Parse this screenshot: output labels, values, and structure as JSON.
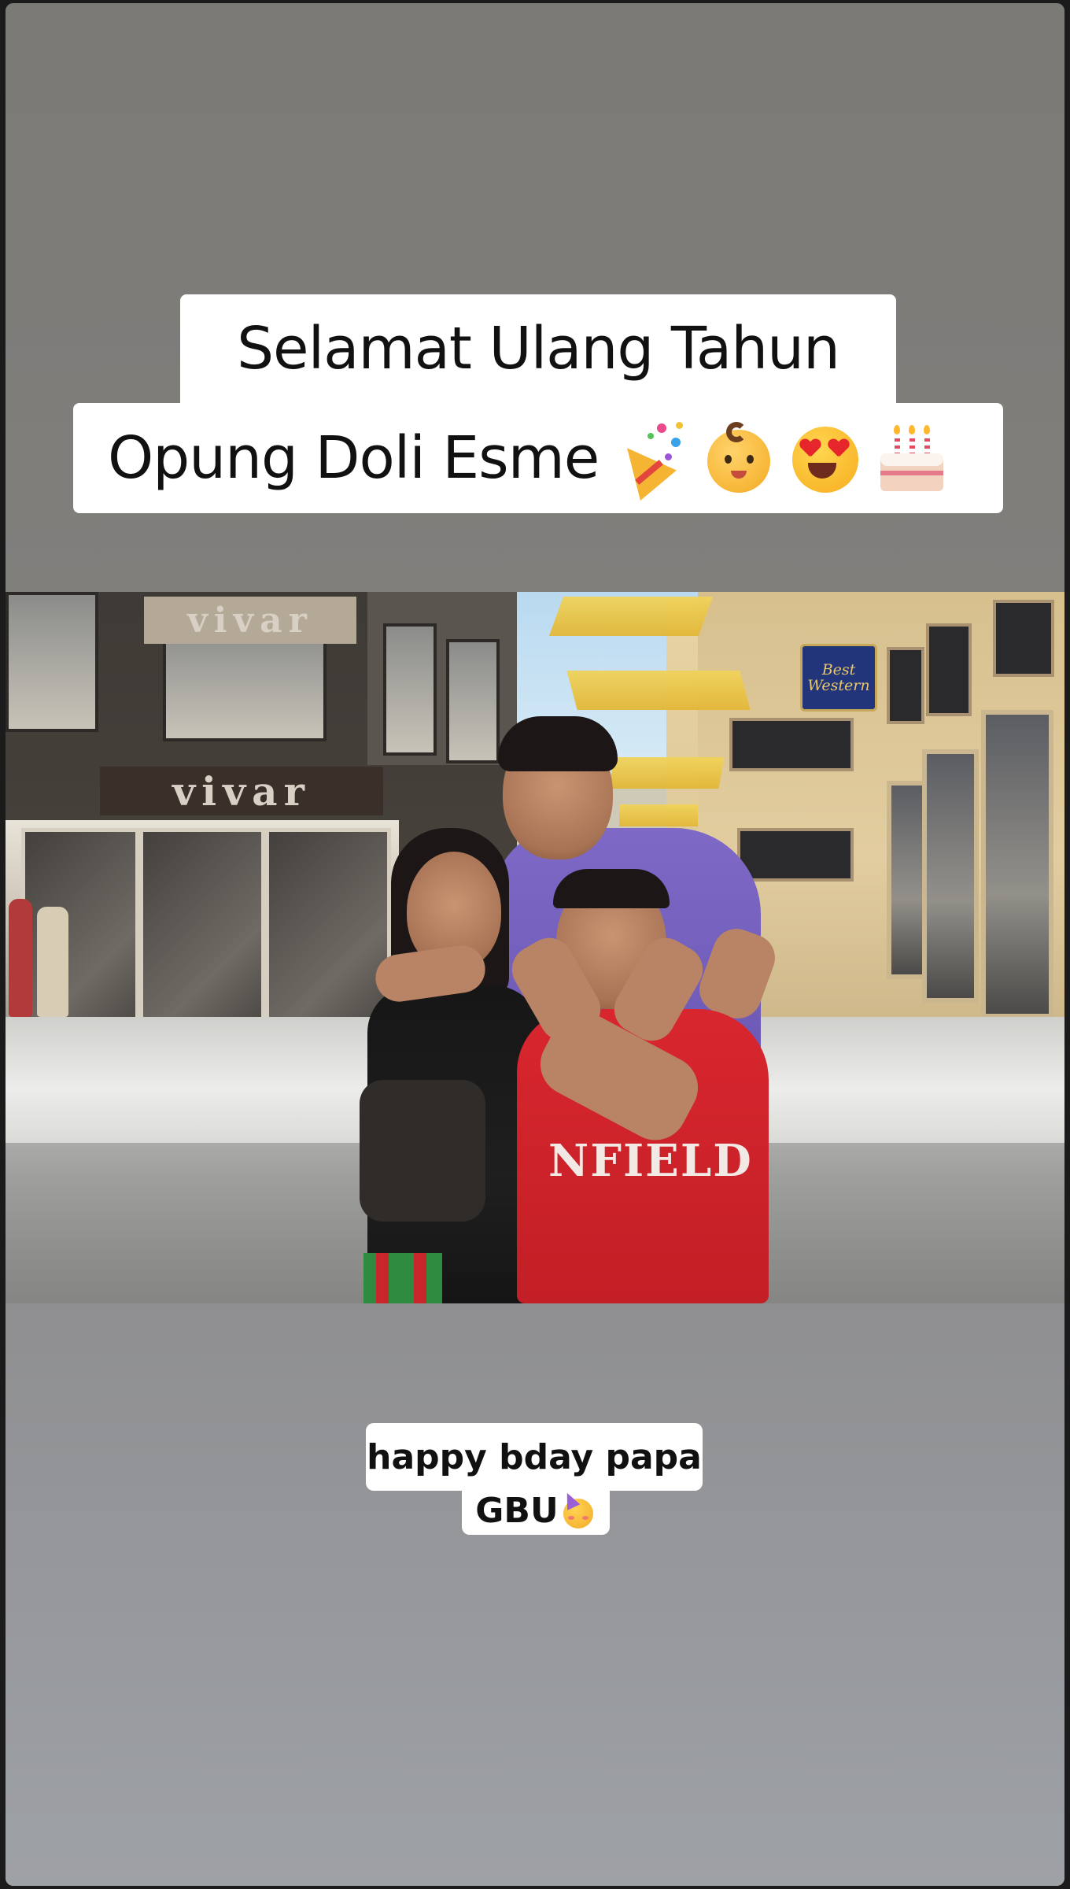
{
  "story": {
    "title_line_1": "Selamat Ulang Tahun",
    "title_line_2": "Opung Doli Esme",
    "title_emojis": [
      "party-popper",
      "baby",
      "heart-eyes",
      "birthday-cake"
    ],
    "caption_line_1": "happy bday papa",
    "caption_line_2": "GBU",
    "caption_emoji": "partying-face"
  },
  "photo": {
    "shop_sign_upper": "vivar",
    "shop_sign_lower": "vivar",
    "hotel_sign": "Best Western",
    "shirt_text": "NFIELD"
  }
}
